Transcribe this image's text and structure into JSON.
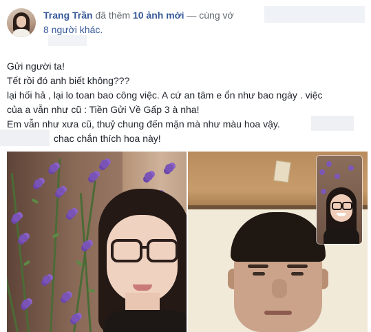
{
  "header": {
    "author_name": "Trang Trần",
    "action_text": "đã thêm",
    "photo_count_text": "10 ảnh mới",
    "with_text": "— cùng vớ",
    "others_text": "8 người khác."
  },
  "post": {
    "lines": [
      "Gửi người ta!",
      "Tết rồi đó anh biết không???",
      "lại hối hả , lại lo toan bao công việc. A cứ an tâm e ổn như bao ngày . việc",
      "của a vẫn như cũ : Tiền Gửi Về Gấp 3 à nha!",
      "Em vẫn như xưa cũ, thuỷ chung đến mặn mà như màu hoa vậy.",
      "chac chắn thích hoa này!"
    ]
  },
  "photos": [
    {
      "label": "woman-with-flowers"
    },
    {
      "label": "video-call-man"
    }
  ]
}
